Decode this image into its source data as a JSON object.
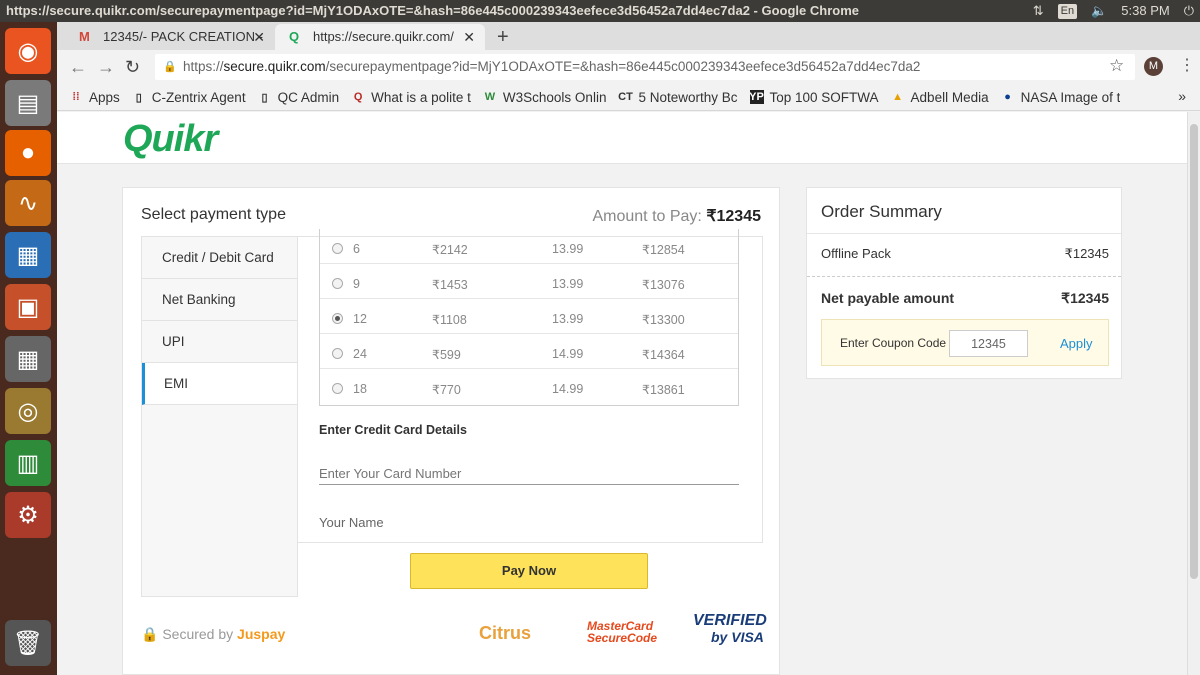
{
  "window": {
    "title": "https://secure.quikr.com/securepaymentpage?id=MjY1ODAxOTE=&hash=86e445c000239343eefece3d56452a7dd4ec7da2 - Google Chrome",
    "language": "En",
    "time": "5:38 PM"
  },
  "tabs": [
    {
      "label": "12345/- PACK CREATION -",
      "icon": "gmail-icon"
    },
    {
      "label": "https://secure.quikr.com/",
      "icon": "quikr-icon"
    }
  ],
  "address": {
    "scheme": "https://",
    "host": "secure.quikr.com",
    "path": "/securepaymentpage?id=MjY1ODAxOTE=&hash=86e445c000239343eefece3d56452a7dd4ec7da2"
  },
  "profile_initial": "M",
  "bookmarks": [
    "Apps",
    "C-Zentrix Agent",
    "QC Admin",
    "What is a polite t",
    "W3Schools Onlin",
    "5 Noteworthy Bc",
    "Top 100 SOFTWA",
    "Adbell Media",
    "NASA Image of t"
  ],
  "page": {
    "logo": "Quikr",
    "payment": {
      "title": "Select payment type",
      "amount_label": "Amount to Pay:",
      "amount": "₹12345",
      "methods": [
        "Credit / Debit Card",
        "Net Banking",
        "UPI",
        "EMI"
      ],
      "active_method": "EMI",
      "emi_rows": [
        {
          "months": "6",
          "emi": "₹2142",
          "rate": "13.99",
          "total": "₹12854",
          "selected": false
        },
        {
          "months": "9",
          "emi": "₹1453",
          "rate": "13.99",
          "total": "₹13076",
          "selected": false
        },
        {
          "months": "12",
          "emi": "₹1108",
          "rate": "13.99",
          "total": "₹13300",
          "selected": true
        },
        {
          "months": "24",
          "emi": "₹599",
          "rate": "14.99",
          "total": "₹14364",
          "selected": false
        },
        {
          "months": "18",
          "emi": "₹770",
          "rate": "14.99",
          "total": "₹13861",
          "selected": false
        }
      ],
      "cc_title": "Enter Credit Card Details",
      "card_placeholder": "Enter Your Card Number",
      "name_placeholder": "Your Name",
      "pay_button": "Pay Now",
      "secured_prefix": "Secured by",
      "secured_brand": "Juspay",
      "badges": {
        "citrus": "Citrus",
        "mastercard_1": "MasterCard",
        "mastercard_2": "SecureCode",
        "visa_1": "VERIFIED",
        "visa_2": "by VISA"
      }
    },
    "summary": {
      "title": "Order Summary",
      "item_label": "Offline Pack",
      "item_value": "₹12345",
      "net_label": "Net payable amount",
      "net_value": "₹12345",
      "coupon_label": "Enter Coupon Code",
      "coupon_value": "12345",
      "apply_label": "Apply"
    }
  },
  "colors": {
    "accent": "#1b8fd8",
    "brand_green": "#1ea757",
    "pay_button": "#fde25a"
  }
}
